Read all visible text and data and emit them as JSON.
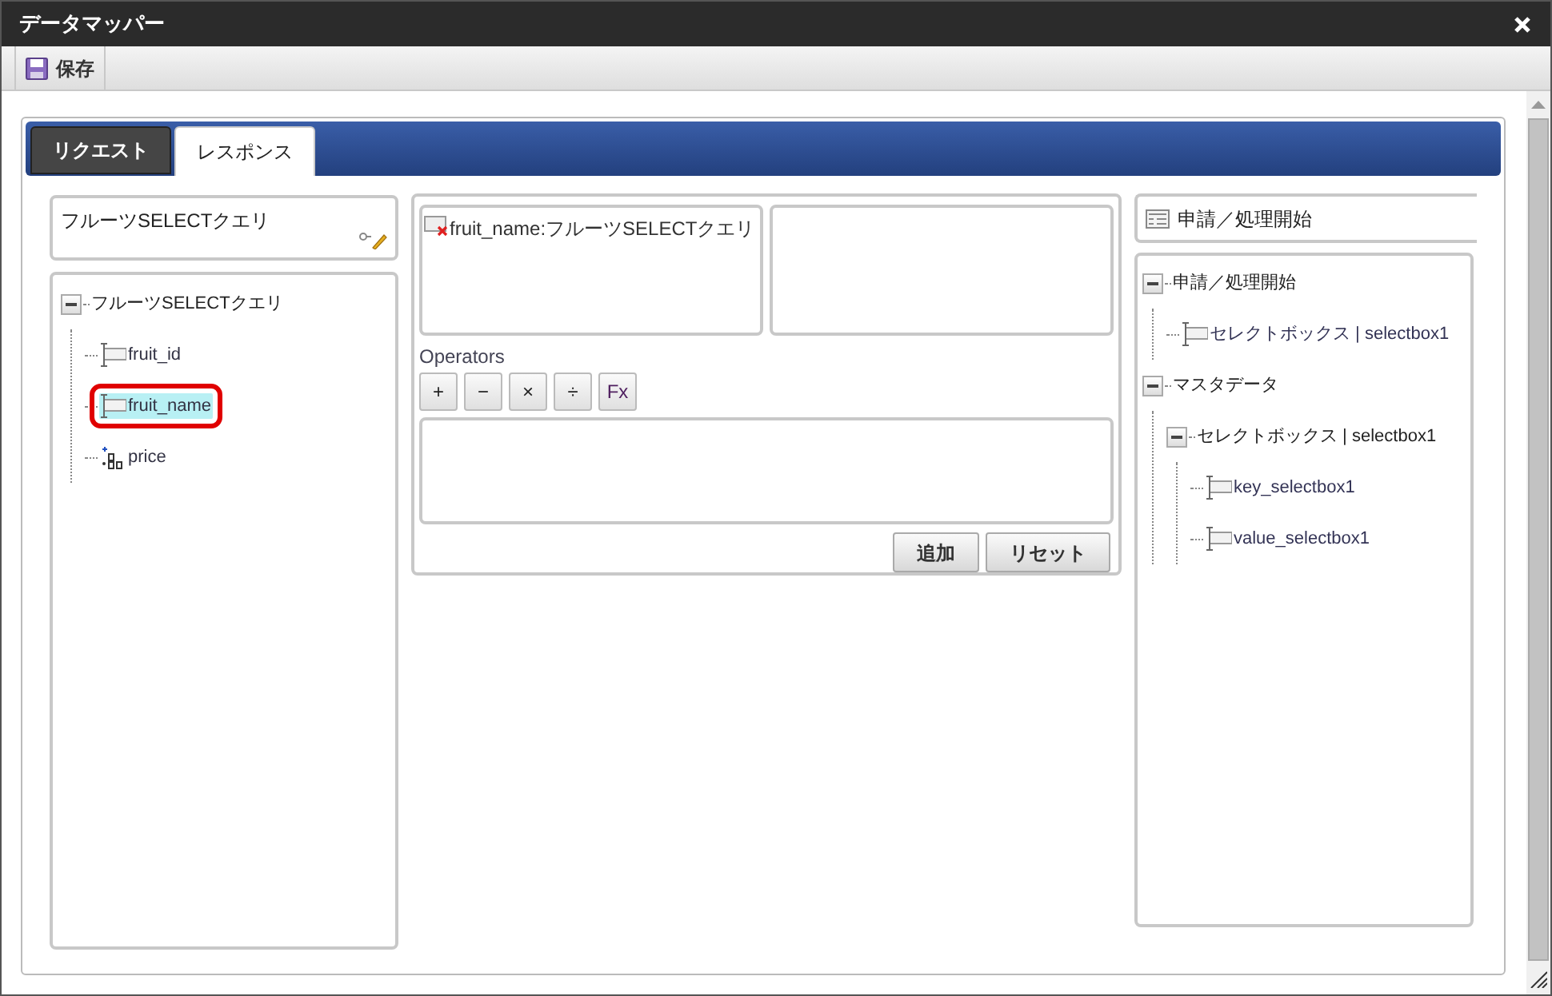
{
  "window": {
    "title": "データマッパー"
  },
  "toolbar": {
    "buttons": [
      {
        "label": "保存",
        "kind": "save"
      }
    ]
  },
  "tabs": [
    {
      "label": "リクエスト",
      "selected": false
    },
    {
      "label": "レスポンス",
      "selected": true
    }
  ],
  "source": {
    "title": "フルーツSELECTクエリ",
    "tree": [
      {
        "label": "フルーツSELECTクエリ",
        "kind": "group",
        "expanded": true,
        "children": [
          {
            "label": "fruit_id",
            "kind": "field",
            "selected": false
          },
          {
            "label": "fruit_name",
            "kind": "field",
            "selected": true
          },
          {
            "label": "price",
            "kind": "number",
            "selected": false
          }
        ]
      }
    ]
  },
  "mapping": {
    "input": {
      "label": "fruit_name:フルーツSELECTクエリ"
    },
    "operators_label": "Operators",
    "operators": [
      "+",
      "−",
      "×",
      "÷",
      "Fx"
    ],
    "buttons": [
      "追加",
      "リセット"
    ]
  },
  "target": {
    "title": "申請／処理開始",
    "tree": [
      {
        "label": "申請／処理開始",
        "kind": "group",
        "expanded": true,
        "children": [
          {
            "label": "セレクトボックス | selectbox1",
            "kind": "field",
            "selected": false
          }
        ]
      },
      {
        "label": "マスタデータ",
        "kind": "group",
        "expanded": true,
        "children": [
          {
            "label": "セレクトボックス | selectbox1",
            "kind": "group",
            "expanded": true,
            "children": [
              {
                "label": "key_selectbox1",
                "kind": "field",
                "selected": false
              },
              {
                "label": "value_selectbox1",
                "kind": "field",
                "selected": false
              }
            ]
          }
        ]
      }
    ]
  }
}
